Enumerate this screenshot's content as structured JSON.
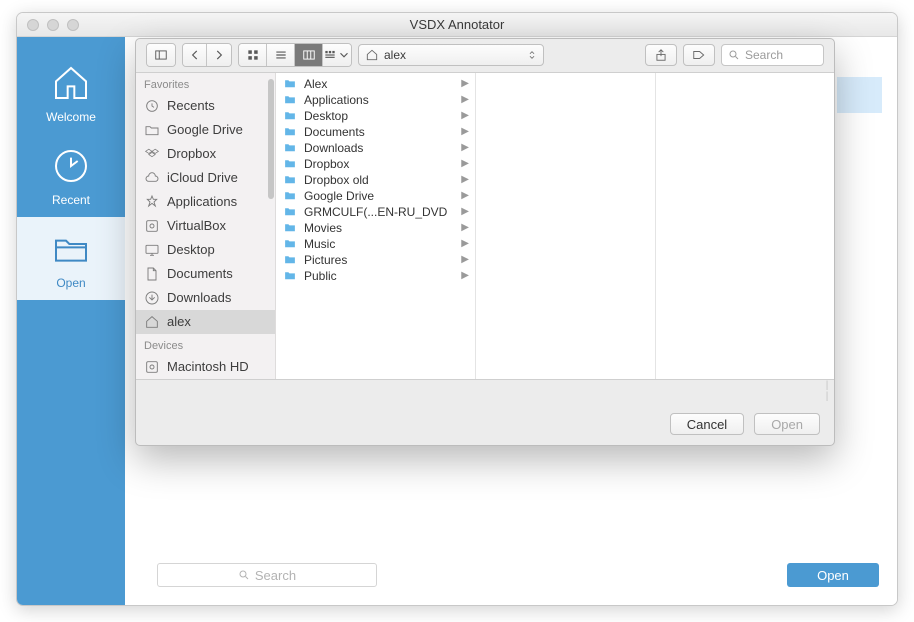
{
  "app": {
    "title": "VSDX Annotator"
  },
  "sidebar": {
    "items": [
      {
        "label": "Welcome",
        "icon": "home-icon"
      },
      {
        "label": "Recent",
        "icon": "clock-icon"
      },
      {
        "label": "Open",
        "icon": "folder-open-icon"
      }
    ]
  },
  "main": {
    "search_placeholder": "Search",
    "open_label": "Open"
  },
  "dialog": {
    "path_label": "alex",
    "search_placeholder": "Search",
    "favorites_header": "Favorites",
    "devices_header": "Devices",
    "favorites": [
      {
        "label": "Recents",
        "icon": "clock-outline-icon"
      },
      {
        "label": "Google Drive",
        "icon": "folder-gray-icon"
      },
      {
        "label": "Dropbox",
        "icon": "dropbox-icon"
      },
      {
        "label": "iCloud Drive",
        "icon": "cloud-icon"
      },
      {
        "label": "Applications",
        "icon": "applications-icon"
      },
      {
        "label": "VirtualBox",
        "icon": "disk-icon"
      },
      {
        "label": "Desktop",
        "icon": "desktop-icon"
      },
      {
        "label": "Documents",
        "icon": "document-icon"
      },
      {
        "label": "Downloads",
        "icon": "downloads-icon"
      },
      {
        "label": "alex",
        "icon": "home-outline-icon"
      }
    ],
    "devices": [
      {
        "label": "Macintosh HD",
        "icon": "disk-icon"
      }
    ],
    "files": [
      {
        "label": "Alex"
      },
      {
        "label": "Applications"
      },
      {
        "label": "Desktop"
      },
      {
        "label": "Documents"
      },
      {
        "label": "Downloads"
      },
      {
        "label": "Dropbox"
      },
      {
        "label": "Dropbox old"
      },
      {
        "label": "Google Drive"
      },
      {
        "label": "GRMCULF(...EN-RU_DVD"
      },
      {
        "label": "Movies"
      },
      {
        "label": "Music"
      },
      {
        "label": "Pictures"
      },
      {
        "label": "Public"
      }
    ],
    "buttons": {
      "cancel": "Cancel",
      "open": "Open"
    }
  }
}
